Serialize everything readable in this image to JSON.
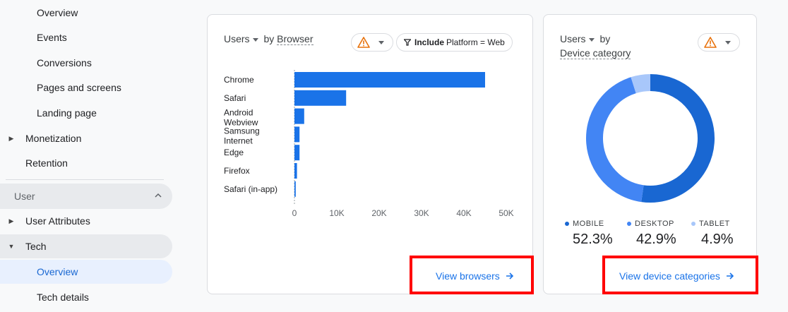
{
  "sidebar": {
    "items": [
      {
        "label": "Overview"
      },
      {
        "label": "Events"
      },
      {
        "label": "Conversions"
      },
      {
        "label": "Pages and screens"
      },
      {
        "label": "Landing page"
      },
      {
        "label": "Monetization"
      },
      {
        "label": "Retention"
      },
      {
        "label": "User"
      },
      {
        "label": "User Attributes"
      },
      {
        "label": "Tech"
      },
      {
        "label": "Overview"
      },
      {
        "label": "Tech details"
      }
    ]
  },
  "browser_card": {
    "title_metric": "Users",
    "title_by": "by",
    "title_dimension": "Browser",
    "filter_include": "Include",
    "filter_text": "Platform = Web",
    "link": "View browsers"
  },
  "device_card": {
    "title_metric": "Users",
    "title_by": "by",
    "title_dimension": "Device category",
    "link": "View device categories",
    "legend": [
      {
        "label": "MOBILE",
        "value": "52.3%"
      },
      {
        "label": "DESKTOP",
        "value": "42.9%"
      },
      {
        "label": "TABLET",
        "value": "4.9%"
      }
    ]
  },
  "colors": {
    "bar": "#1a73e8",
    "mobile": "#1967d2",
    "desktop": "#4285f4",
    "tablet": "#a8c7fa",
    "link": "#1a73e8",
    "highlight": "#ff0000"
  },
  "chart_data": [
    {
      "type": "bar",
      "orientation": "horizontal",
      "categories": [
        "Chrome",
        "Safari",
        "Android Webview",
        "Samsung Internet",
        "Edge",
        "Firefox",
        "Safari (in-app)"
      ],
      "values": [
        45000,
        12200,
        2300,
        1200,
        1200,
        600,
        300
      ],
      "xlim": [
        0,
        50000
      ],
      "tick_labels": [
        "0",
        "10K",
        "20K",
        "30K",
        "40K",
        "50K"
      ],
      "tick_values": [
        0,
        10000,
        20000,
        30000,
        40000,
        50000
      ]
    },
    {
      "type": "pie",
      "donut": true,
      "categories": [
        "MOBILE",
        "DESKTOP",
        "TABLET"
      ],
      "values": [
        52.3,
        42.9,
        4.9
      ]
    }
  ]
}
